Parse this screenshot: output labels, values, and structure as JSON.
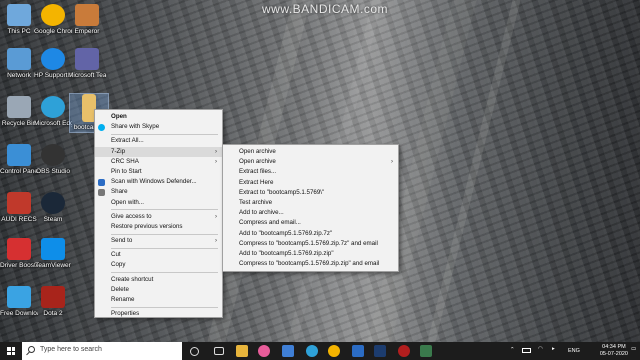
{
  "watermark": "www.BANDICAM.com",
  "desktop_icons": [
    {
      "label": "This PC",
      "color": "#6fa8dc"
    },
    {
      "label": "Google Chrome",
      "color": "#f4b400"
    },
    {
      "label": "Emperor",
      "color": "#c97b3a"
    },
    {
      "label": "Network",
      "color": "#5a9bd5"
    },
    {
      "label": "HP Support Assistant",
      "color": "#1e88e5"
    },
    {
      "label": "Microsoft Teams",
      "color": "#6264a7"
    },
    {
      "label": "Recycle Bin",
      "color": "#9aa7b5"
    },
    {
      "label": "Microsoft Edge",
      "color": "#2ea1d8"
    },
    {
      "label": "bootcam...",
      "color": "#e8c06a"
    },
    {
      "label": "Control Panel",
      "color": "#3b8fd6"
    },
    {
      "label": "OBS Studio",
      "color": "#333333"
    },
    {
      "label": "AUDI RECS",
      "color": "#c0392b"
    },
    {
      "label": "Steam",
      "color": "#1b2838"
    },
    {
      "label": "Driver Booster 7",
      "color": "#d63031"
    },
    {
      "label": "TeamViewer",
      "color": "#0e8ee9"
    },
    {
      "label": "Free Downloa...",
      "color": "#3aa3e3"
    },
    {
      "label": "Dota 2",
      "color": "#a8241b"
    }
  ],
  "context_menu": {
    "items": [
      "Open",
      "Share with Skype",
      "Extract All...",
      "7-Zip",
      "CRC SHA",
      "Pin to Start",
      "Scan with Windows Defender...",
      "Share",
      "Open with...",
      "Give access to",
      "Restore previous versions",
      "Send to",
      "Cut",
      "Copy",
      "Create shortcut",
      "Delete",
      "Rename",
      "Properties"
    ]
  },
  "submenu_7zip": {
    "items": [
      "Open archive",
      "Open archive",
      "Extract files...",
      "Extract Here",
      "Extract to \"bootcamp5.1.5769\\\"",
      "Test archive",
      "Add to archive...",
      "Compress and email...",
      "Add to \"bootcamp5.1.5769.zip.7z\"",
      "Compress to \"bootcamp5.1.5769.zip.7z\" and email",
      "Add to \"bootcamp5.1.5769.zip.zip\"",
      "Compress to \"bootcamp5.1.5769.zip.zip\" and email"
    ]
  },
  "taskbar": {
    "search_placeholder": "Type here to search",
    "tray_lang": "ENG",
    "time": "04:34 PM",
    "date": "05-07-2020"
  }
}
